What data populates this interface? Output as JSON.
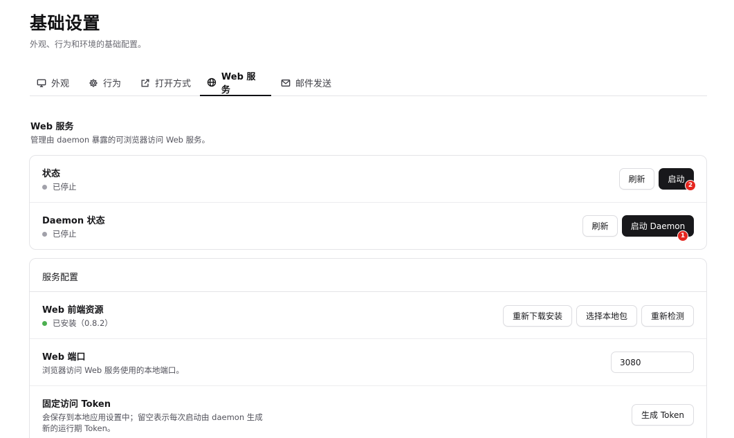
{
  "page": {
    "title": "基础设置",
    "subtitle": "外观、行为和环境的基础配置。"
  },
  "tabs": [
    {
      "label": "外观",
      "icon": "monitor-icon"
    },
    {
      "label": "行为",
      "icon": "gear-icon"
    },
    {
      "label": "打开方式",
      "icon": "external-link-icon"
    },
    {
      "label": "Web 服务",
      "icon": "globe-icon",
      "active": true
    },
    {
      "label": "邮件发送",
      "icon": "mail-icon"
    }
  ],
  "section": {
    "title": "Web 服务",
    "description": "管理由 daemon 暴露的可浏览器访问 Web 服务。"
  },
  "status_card": {
    "status": {
      "title": "状态",
      "value": "已停止",
      "dot_color": "#a1a1aa",
      "refresh_label": "刷新",
      "start_label": "启动",
      "badge": "2"
    },
    "daemon": {
      "title": "Daemon 状态",
      "value": "已停止",
      "dot_color": "#a1a1aa",
      "refresh_label": "刷新",
      "start_label": "启动 Daemon",
      "badge": "1"
    }
  },
  "config_card": {
    "header": "服务配置",
    "frontend": {
      "title": "Web 前端资源",
      "value": "已安装（0.8.2）",
      "dot_color": "#4caf50",
      "redownload_label": "重新下载安装",
      "choose_local_label": "选择本地包",
      "recheck_label": "重新检测"
    },
    "port": {
      "title": "Web 端口",
      "description": "浏览器访问 Web 服务使用的本地端口。",
      "value": "3080"
    },
    "token": {
      "title": "固定访问 Token",
      "description_line1": "会保存到本地应用设置中；留空表示每次启动由 daemon 生成",
      "description_line2": "新的运行期 Token。",
      "generate_label": "生成 Token"
    }
  }
}
